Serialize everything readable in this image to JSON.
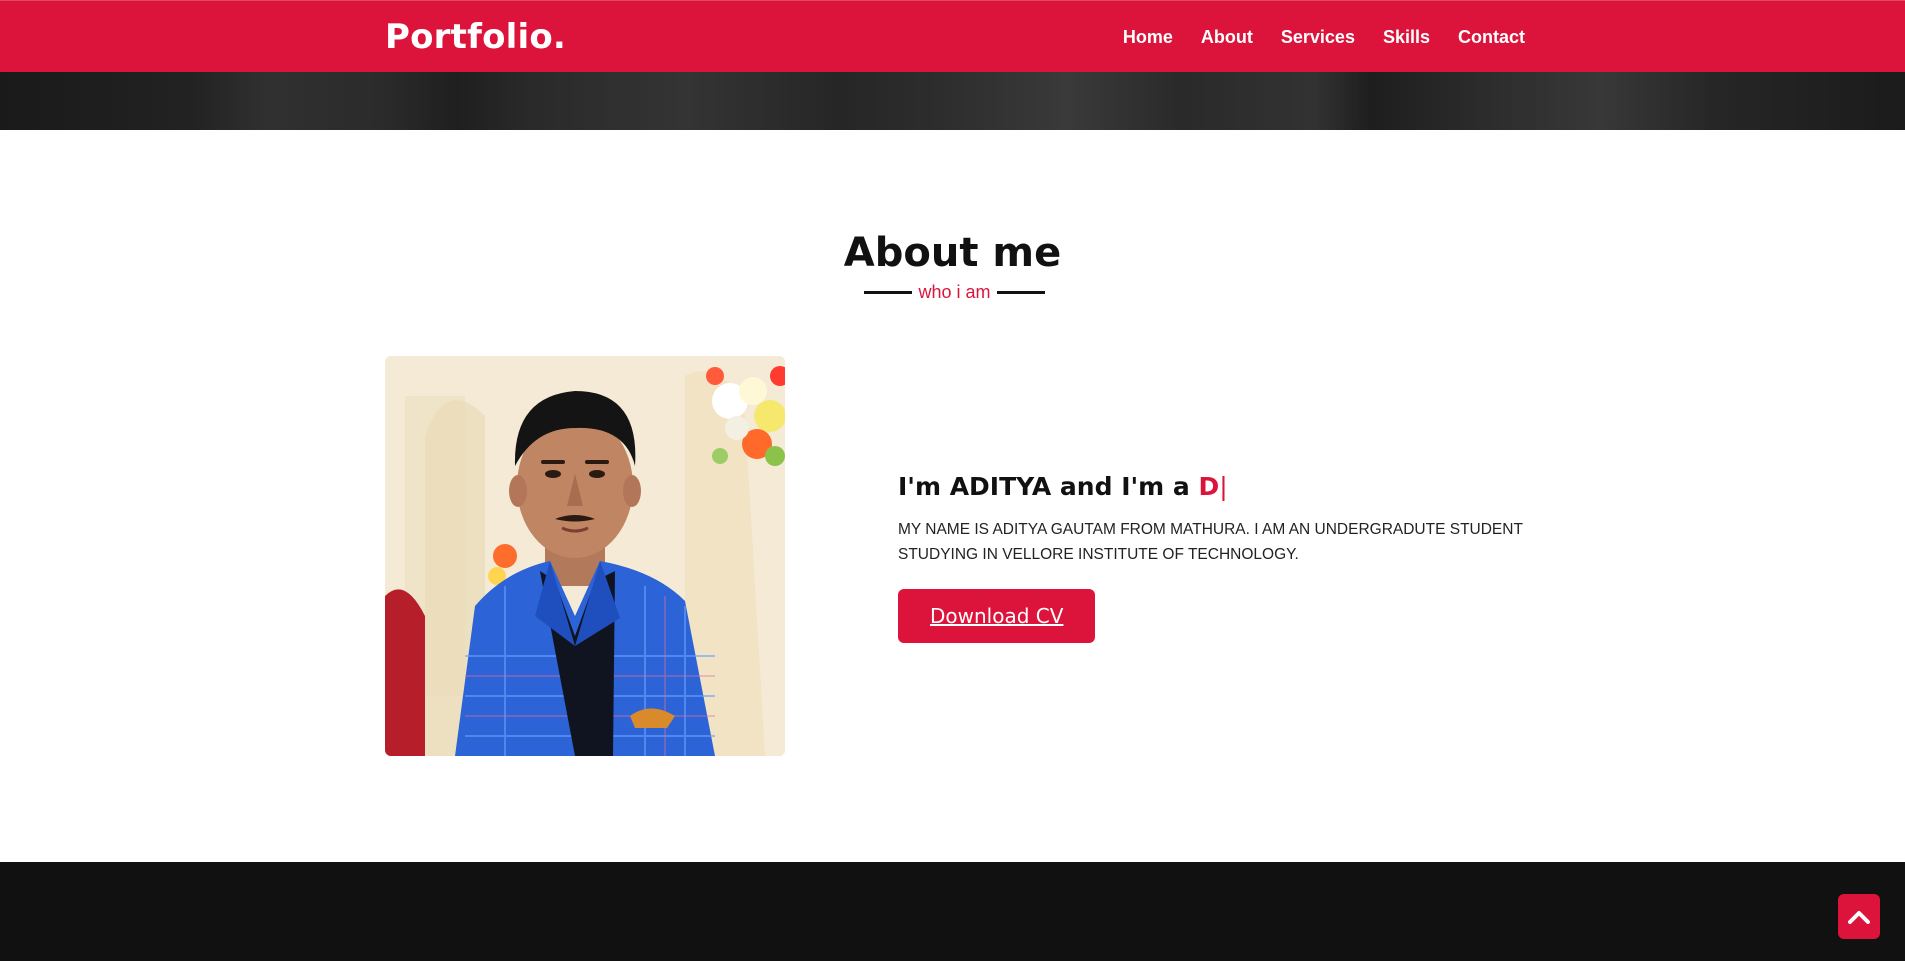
{
  "navbar": {
    "logo": "Portfolio.",
    "menu": [
      "Home",
      "About",
      "Services",
      "Skills",
      "Contact"
    ]
  },
  "about": {
    "title": "About me",
    "subtitle": "who i am",
    "headline_prefix": "I'm ADITYA and I'm a ",
    "headline_typed": "D",
    "headline_cursor": "|",
    "description": "MY NAME IS ADITYA GAUTAM FROM MATHURA. I AM AN UNDERGRADUTE STUDENT STUDYING IN VELLORE INSTITUTE OF TECHNOLOGY.",
    "download_button": "Download CV"
  },
  "scroll_top": {
    "icon": "chevron-up-icon"
  },
  "colors": {
    "accent": "#dc143c",
    "dark": "#111111",
    "white": "#ffffff"
  }
}
